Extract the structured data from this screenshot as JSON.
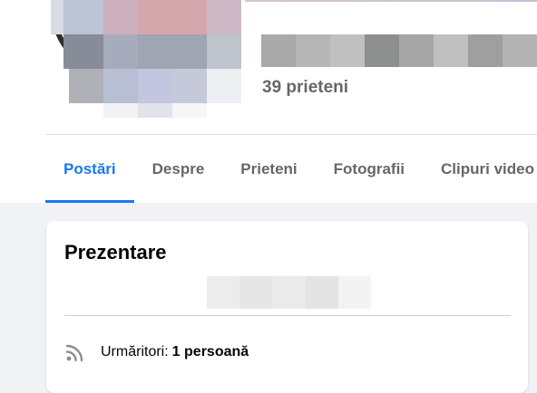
{
  "profile": {
    "friends_count": "39 prieteni"
  },
  "tabs": [
    {
      "label": "Postări",
      "active": true
    },
    {
      "label": "Despre",
      "active": false
    },
    {
      "label": "Prieteni",
      "active": false
    },
    {
      "label": "Fotografii",
      "active": false
    },
    {
      "label": "Clipuri video",
      "active": false
    }
  ],
  "intro": {
    "title": "Prezentare",
    "followers_label": "Urmăritori:",
    "followers_value": "1 persoană",
    "icon": "rss-icon"
  },
  "colors": {
    "accent": "#1877f2",
    "secondary_text": "#65676b",
    "background": "#f0f2f5"
  }
}
